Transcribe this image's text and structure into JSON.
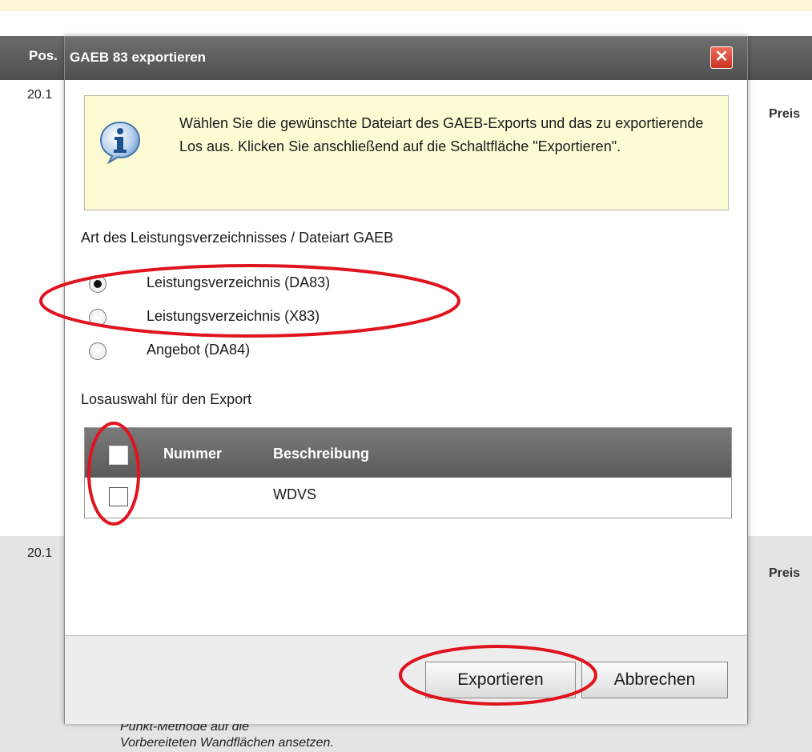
{
  "background": {
    "header_pos": "Pos.",
    "row_numbers": [
      "20.1",
      "20.1"
    ],
    "preis_labels": [
      "Preis",
      "Preis"
    ],
    "italic_lines": [
      "Punkt-Methode auf die",
      "Vorbereiteten Wandflächen ansetzen."
    ]
  },
  "dialog": {
    "title": "GAEB 83 exportieren",
    "close_icon": "close-icon",
    "info_icon": "info-icon",
    "info_text": "Wählen Sie die gewünschte Dateiart des GAEB-Exports und das zu exportierende Los aus. Klicken Sie anschließend auf die Schaltfläche \"Exportieren\".",
    "filetype_label": "Art des Leistungsverzeichnisses / Dateiart GAEB",
    "options": [
      {
        "label": "Leistungsverzeichnis (DA83)",
        "checked": true
      },
      {
        "label": "Leistungsverzeichnis (X83)",
        "checked": false
      },
      {
        "label": "Angebot (DA84)",
        "checked": false
      }
    ],
    "lot_label": "Losauswahl für den Export",
    "table": {
      "headers": [
        "Nummer",
        "Beschreibung"
      ],
      "rows": [
        {
          "nummer": "",
          "beschreibung": "WDVS",
          "checked": false
        }
      ]
    },
    "buttons": {
      "export": "Exportieren",
      "cancel": "Abbrechen"
    }
  },
  "colors": {
    "annotation": "#e0141e",
    "info_bg": "#fdfbd4",
    "header_bg": "#5a5a5a"
  }
}
